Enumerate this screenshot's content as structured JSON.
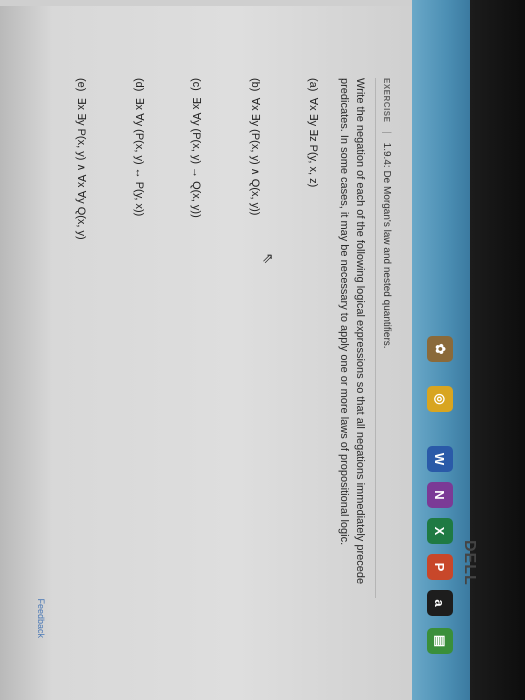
{
  "header": {
    "badge": "EXERCISE",
    "title": "1.9.4: De Morgan's law and nested quantifiers."
  },
  "instructions": "Write the negation of each of the following logical expressions so that all negations immediately precede predicates. In some cases, it may be necessary to apply one or more laws of propositional logic.",
  "parts": [
    {
      "label": "(a)",
      "expr": "∀x ∃y ∃z P(y, x, z)"
    },
    {
      "label": "(b)",
      "expr": "∀x ∃y (P(x, y) ∧ Q(x, y))"
    },
    {
      "label": "(c)",
      "expr": "∃x ∀y (P(x, y) → Q(x, y))"
    },
    {
      "label": "(d)",
      "expr": "∃x ∀y (P(x, y) ↔ P(y, x))"
    },
    {
      "label": "(e)",
      "expr": "∃x ∃y P(x, y) ∧ ∀x ∀y Q(x, y)"
    }
  ],
  "feedback_link": "Feedback",
  "taskbar": {
    "icons": [
      {
        "name": "store-icon",
        "glyph": "▤",
        "color": "#3a8f3a"
      },
      {
        "name": "amazon-icon",
        "glyph": "a",
        "color": "#1d1d1d"
      },
      {
        "name": "powerpoint-icon",
        "glyph": "P",
        "color": "#c8472a"
      },
      {
        "name": "excel-icon",
        "glyph": "X",
        "color": "#1f7a43"
      },
      {
        "name": "onenote-icon",
        "glyph": "N",
        "color": "#7b3a96"
      },
      {
        "name": "word-icon",
        "glyph": "W",
        "color": "#2a5aa8"
      },
      {
        "name": "chrome-icon",
        "glyph": "◎",
        "color": "#d8a520"
      },
      {
        "name": "app-icon",
        "glyph": "✿",
        "color": "#8a6a3a"
      }
    ]
  },
  "monitor_brand": "DELL"
}
